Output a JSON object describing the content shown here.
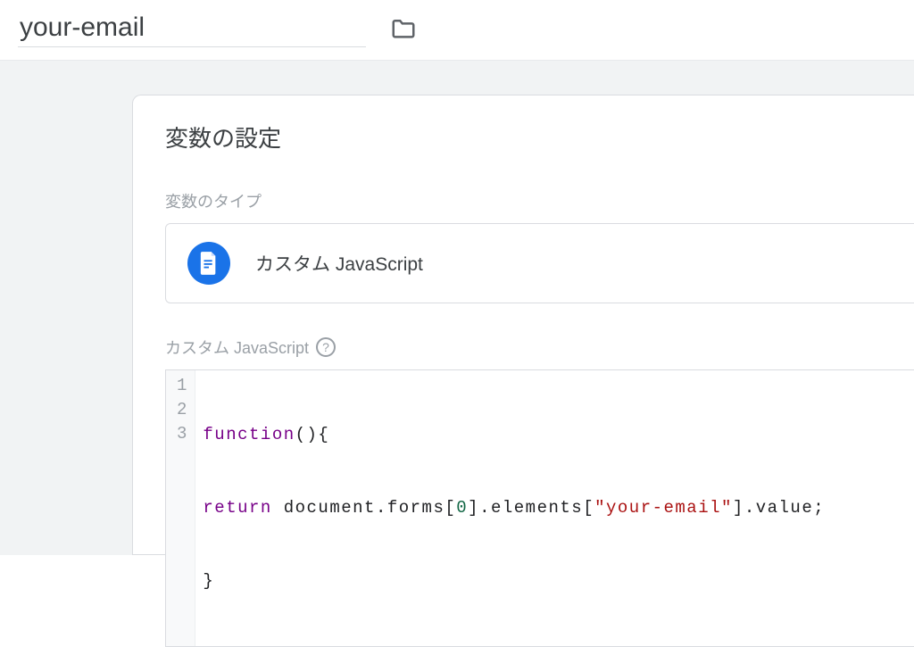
{
  "header": {
    "title_value": "your-email"
  },
  "card": {
    "section_title": "変数の設定",
    "type_label": "変数のタイプ",
    "type_name": "カスタム JavaScript",
    "editor_label": "カスタム JavaScript",
    "code": {
      "line_nums": [
        "1",
        "2",
        "3"
      ],
      "l1_kw": "function",
      "l1_rest": "(){",
      "l2_kw": "return",
      "l2_a": " document.forms[",
      "l2_num": "0",
      "l2_b": "].elements[",
      "l2_str": "\"your-email\"",
      "l2_c": "].value;",
      "l3": "}"
    }
  }
}
